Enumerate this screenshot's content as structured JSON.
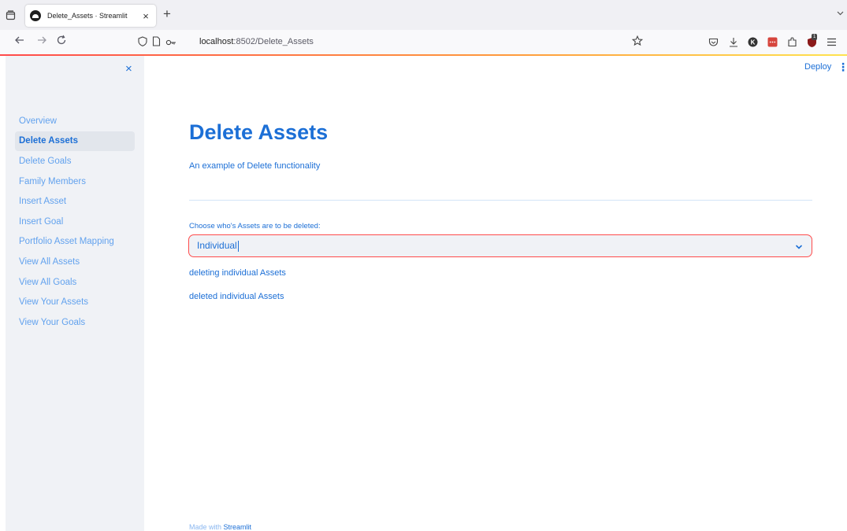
{
  "browser": {
    "tab_title": "Delete_Assets · Streamlit",
    "tab_close": "×",
    "new_tab": "+",
    "url_host": "localhost",
    "url_path": ":8502/Delete_Assets",
    "extension_badge": "1"
  },
  "sidebar": {
    "close_icon": "×",
    "items": [
      {
        "label": "Overview"
      },
      {
        "label": "Delete Assets"
      },
      {
        "label": "Delete Goals"
      },
      {
        "label": "Family Members"
      },
      {
        "label": "Insert Asset"
      },
      {
        "label": "Insert Goal"
      },
      {
        "label": "Portfolio Asset Mapping"
      },
      {
        "label": "View All Assets"
      },
      {
        "label": "View All Goals"
      },
      {
        "label": "View Your Assets"
      },
      {
        "label": "View Your Goals"
      }
    ],
    "active_index": 1
  },
  "header": {
    "deploy_label": "Deploy",
    "menu_icon": "⋮"
  },
  "main": {
    "title": "Delete Assets",
    "subtitle": "An example of Delete functionality",
    "select_label": "Choose who's Assets are to be deleted:",
    "select_value": "Individual",
    "messages": [
      "deleting individual Assets",
      "deleted individual Assets"
    ]
  },
  "footer": {
    "prefix": "Made with ",
    "brand": "Streamlit"
  },
  "colors": {
    "accent": "#1c6fd6",
    "error_border": "#ff4b4b",
    "sidebar_bg": "#f0f2f6"
  }
}
